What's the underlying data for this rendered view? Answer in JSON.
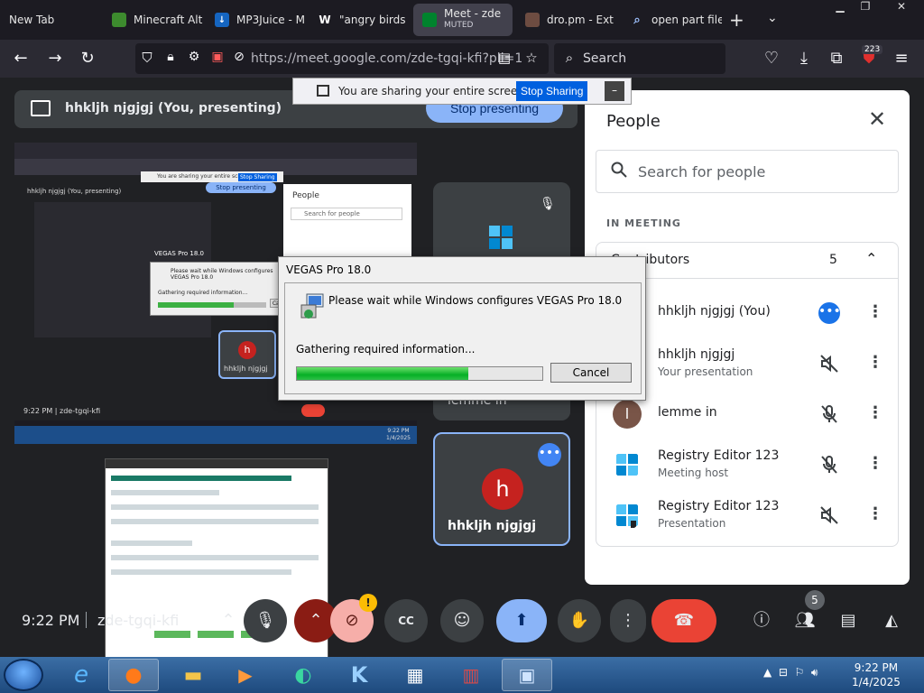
{
  "browser": {
    "tabs": [
      {
        "title": "New Tab"
      },
      {
        "title": "Minecraft Alt"
      },
      {
        "title": "MP3Juice - M"
      },
      {
        "title": "\"angry birds"
      },
      {
        "title": "Meet - zde",
        "sub": "MUTED",
        "active": true
      },
      {
        "title": "dro.pm - Ext"
      },
      {
        "title": "open part file"
      }
    ],
    "url": "https://meet.google.com/zde-tgqi-kfi?pli=1",
    "search_placeholder": "Search",
    "extension_badge": "223"
  },
  "share_notice": {
    "text": "You are sharing your entire screen.",
    "stop_label": "Stop Sharing",
    "minimize_label": "–"
  },
  "presenting": {
    "label": "hhkljh njgjgj (You, presenting)",
    "stop_label": "Stop presenting"
  },
  "tiles": {
    "lemme_name": "lemme in",
    "me_name": "hhkljh njgjgj",
    "me_initial": "h"
  },
  "vegas": {
    "title": "VEGAS Pro 18.0",
    "message": "Please wait while Windows configures VEGAS Pro 18.0",
    "status": "Gathering required information...",
    "progress": 0.7,
    "cancel_label": "Cancel"
  },
  "people": {
    "title": "People",
    "search_placeholder": "Search for people",
    "section": "IN MEETING",
    "group_label": "Contributors",
    "group_count": "5",
    "participants": [
      {
        "name": "hhkljh njgjgj (You)",
        "sub": "",
        "status": "more-options"
      },
      {
        "name": "hhkljh njgjgj",
        "sub": "Your presentation",
        "status": "audio-off"
      },
      {
        "name": "lemme in",
        "sub": "",
        "status": "mic-off",
        "initial": "l"
      },
      {
        "name": "Registry Editor 123",
        "sub": "Meeting host",
        "status": "mic-off"
      },
      {
        "name": "Registry Editor 123",
        "sub": "Presentation",
        "status": "audio-off"
      }
    ]
  },
  "meeting": {
    "time": "9:22 PM",
    "code": "zde-tgqi-kfi",
    "warning": "!",
    "people_count": "5"
  },
  "thumb": {
    "meeting_info": "9:22 PM  |  zde-tgqi-kfi",
    "tile_name": "hhkljh njgjgj",
    "tile_initial": "h",
    "people_title": "People",
    "people_search": "Search for people",
    "presenting_label": "hhkljh njgjgj (You, presenting)",
    "stop_presenting": "Stop presenting",
    "vegas_title": "VEGAS Pro 18.0",
    "vegas_message": "Please wait while Windows configures VEGAS Pro 18.0",
    "vegas_status": "Gathering required information...",
    "vegas_cancel": "Cancel",
    "share_notice": "You are sharing your entire screen",
    "stop_sharing": "Stop Sharing",
    "taskbar_clock": "9:22 PM\n1/4/2025"
  },
  "taskbar": {
    "time": "9:22 PM",
    "date": "1/4/2025"
  },
  "colors": {
    "meet_bg": "#202124",
    "accent_blue": "#8ab4f8",
    "end_call_red": "#ea4335",
    "progress_green": "#06b025"
  }
}
